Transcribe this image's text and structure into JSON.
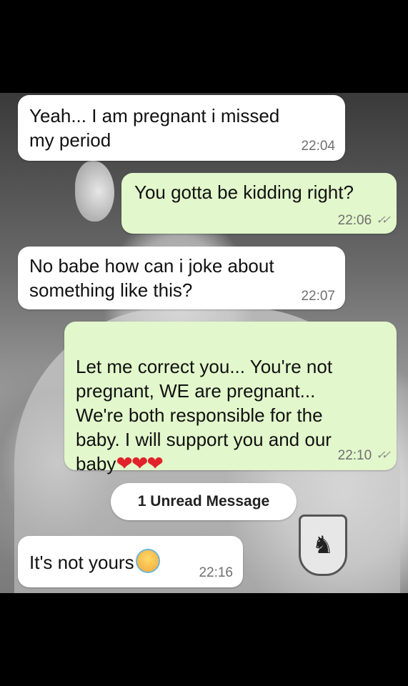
{
  "messages": [
    {
      "text": "Yeah... I am pregnant i missed\nmy period",
      "time": "22:04"
    },
    {
      "text": "You gotta be kidding right?",
      "time": "22:06"
    },
    {
      "text": "No babe how can i joke about\nsomething like this?",
      "time": "22:07"
    },
    {
      "text": "Let me correct you... You're not\npregnant, WE are pregnant...\nWe're both responsible for the\nbaby. I will support you and our\nbaby",
      "emoji": "❤❤❤",
      "time": "22:10"
    },
    {
      "text": "It's not yours",
      "time": "22:16"
    }
  ],
  "unread_banner": "1 Unread Message",
  "read_ticks": "✓✓",
  "colors": {
    "incoming_bubble": "#ffffff",
    "outgoing_bubble": "#e2f7cb",
    "hearts": "#e0232b"
  }
}
